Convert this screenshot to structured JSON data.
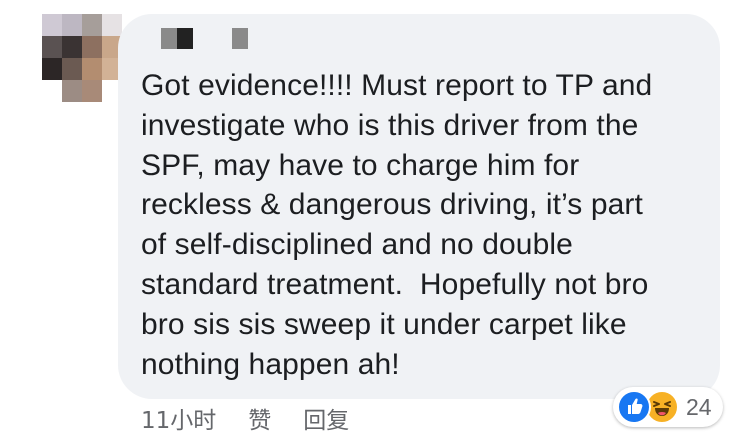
{
  "comment": {
    "author_redacted": true,
    "text_lines": [
      "Got evidence!!!! Must report to TP and",
      "investigate who is this driver from the",
      "SPF, may have to charge him for",
      "reckless & dangerous driving, it’s part",
      "of self-disciplined and no double",
      "standard treatment.  Hopefully not bro",
      "bro sis sis sweep it under carpet like",
      "nothing happen ah!"
    ]
  },
  "actions": {
    "timestamp": "11小时",
    "like_label": "赞",
    "reply_label": "回复"
  },
  "reactions": {
    "icons": [
      "like-icon",
      "haha-icon"
    ],
    "count": "24"
  },
  "colors": {
    "bubble_bg": "#f0f2f5",
    "text": "#1c1e21",
    "meta_text": "#65676b",
    "like_blue": "#1877f2",
    "haha_yellow": "#f7b125"
  }
}
